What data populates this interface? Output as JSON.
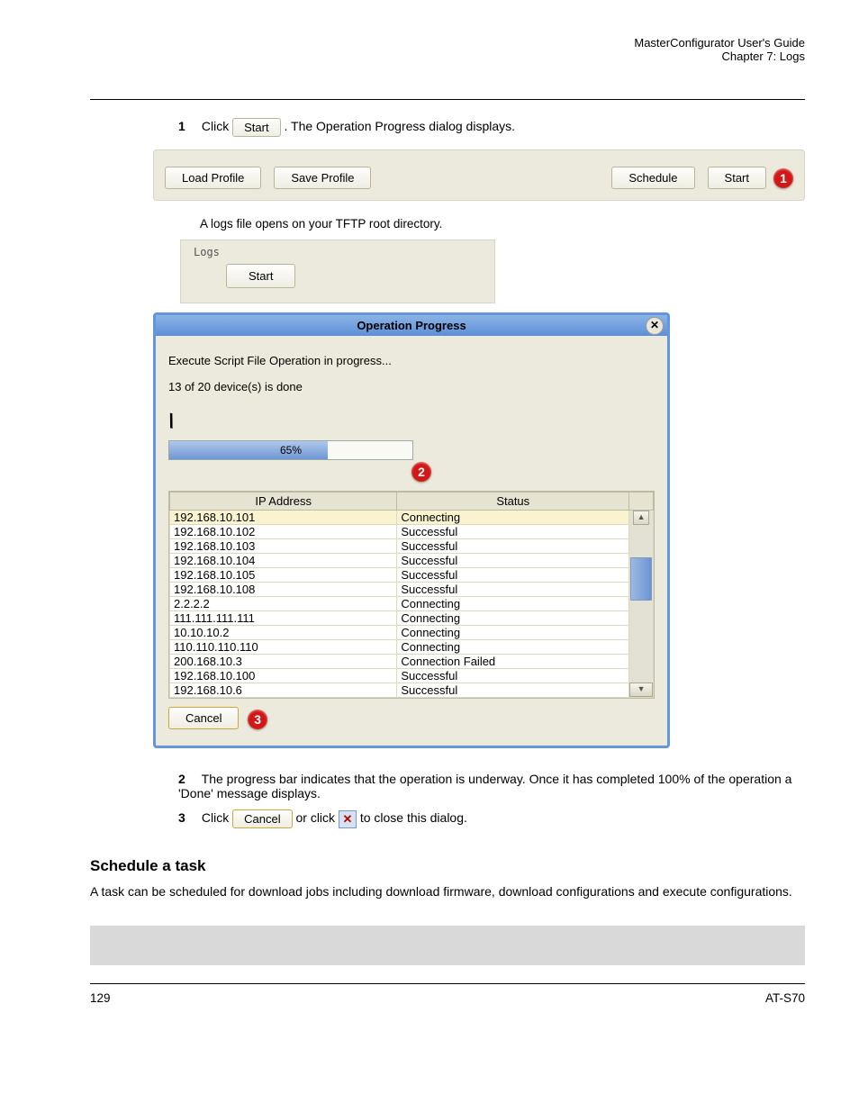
{
  "header": {
    "doc_title": "MasterConfigurator User's Guide",
    "chapter": "Chapter 7: Logs"
  },
  "steps": {
    "s1_num": "1",
    "s1_text": "Click ",
    "start_btn": "Start",
    "s1_tail": ". The Operation Progress dialog displays.",
    "hint": "A logs file opens on your TFTP root directory."
  },
  "toolbar": {
    "load_profile": "Load Profile",
    "save_profile": "Save Profile",
    "schedule": "Schedule",
    "start": "Start"
  },
  "logs_label": "Logs",
  "dialog": {
    "title": "Operation Progress",
    "msg": "Execute Script File Operation in progress...",
    "count": "13 of 20 device(s) is done",
    "progress_pct": "65%",
    "progress_width": "65%",
    "col_ip": "IP Address",
    "col_status": "Status",
    "rows": [
      {
        "ip": "192.168.10.101",
        "status": "Connecting"
      },
      {
        "ip": "192.168.10.102",
        "status": "Successful"
      },
      {
        "ip": "192.168.10.103",
        "status": "Successful"
      },
      {
        "ip": "192.168.10.104",
        "status": "Successful"
      },
      {
        "ip": "192.168.10.105",
        "status": "Successful"
      },
      {
        "ip": "192.168.10.108",
        "status": "Successful"
      },
      {
        "ip": "2.2.2.2",
        "status": "Connecting"
      },
      {
        "ip": "111.111.111.111",
        "status": "Connecting"
      },
      {
        "ip": "10.10.10.2",
        "status": "Connecting"
      },
      {
        "ip": "110.110.110.110",
        "status": "Connecting"
      },
      {
        "ip": "200.168.10.3",
        "status": "Connection Failed"
      },
      {
        "ip": "192.168.10.100",
        "status": "Successful"
      },
      {
        "ip": "192.168.10.6",
        "status": "Successful"
      }
    ],
    "cancel": "Cancel"
  },
  "callouts": {
    "c1": "1",
    "c2": "2",
    "c3": "3"
  },
  "steps2": {
    "s2_num": "2",
    "s2_text": "The progress bar indicates that the operation is underway. Once it has completed 100% of the operation a 'Done' message displays.",
    "s3_num": "3",
    "s3_text_a": "Click ",
    "s3_text_b": " or click ",
    "s3_text_c": " to close this dialog.",
    "cancel_inline": "Cancel"
  },
  "section": {
    "heading": "Schedule a task",
    "para": "A task can be scheduled for download jobs including download firmware, download configurations and execute configurations."
  },
  "footer": {
    "left": "129",
    "right": "AT-S70"
  }
}
